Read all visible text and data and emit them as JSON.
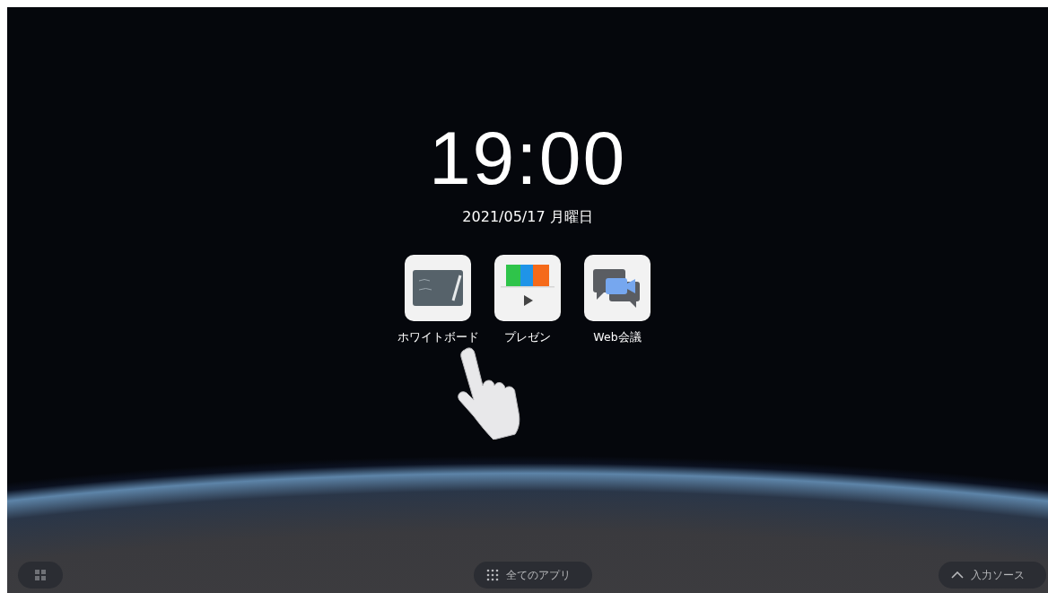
{
  "clock": {
    "time": "19:00",
    "date": "2021/05/17 月曜日"
  },
  "apps": [
    {
      "kind": "whiteboard",
      "label": "ホワイトボード"
    },
    {
      "kind": "presentation",
      "label": "プレゼン"
    },
    {
      "kind": "meeting",
      "label": "Web会議"
    }
  ],
  "bottom_bar": {
    "all_apps": {
      "label": "全てのアプリ"
    },
    "input_source": {
      "label": "入力ソース"
    }
  }
}
